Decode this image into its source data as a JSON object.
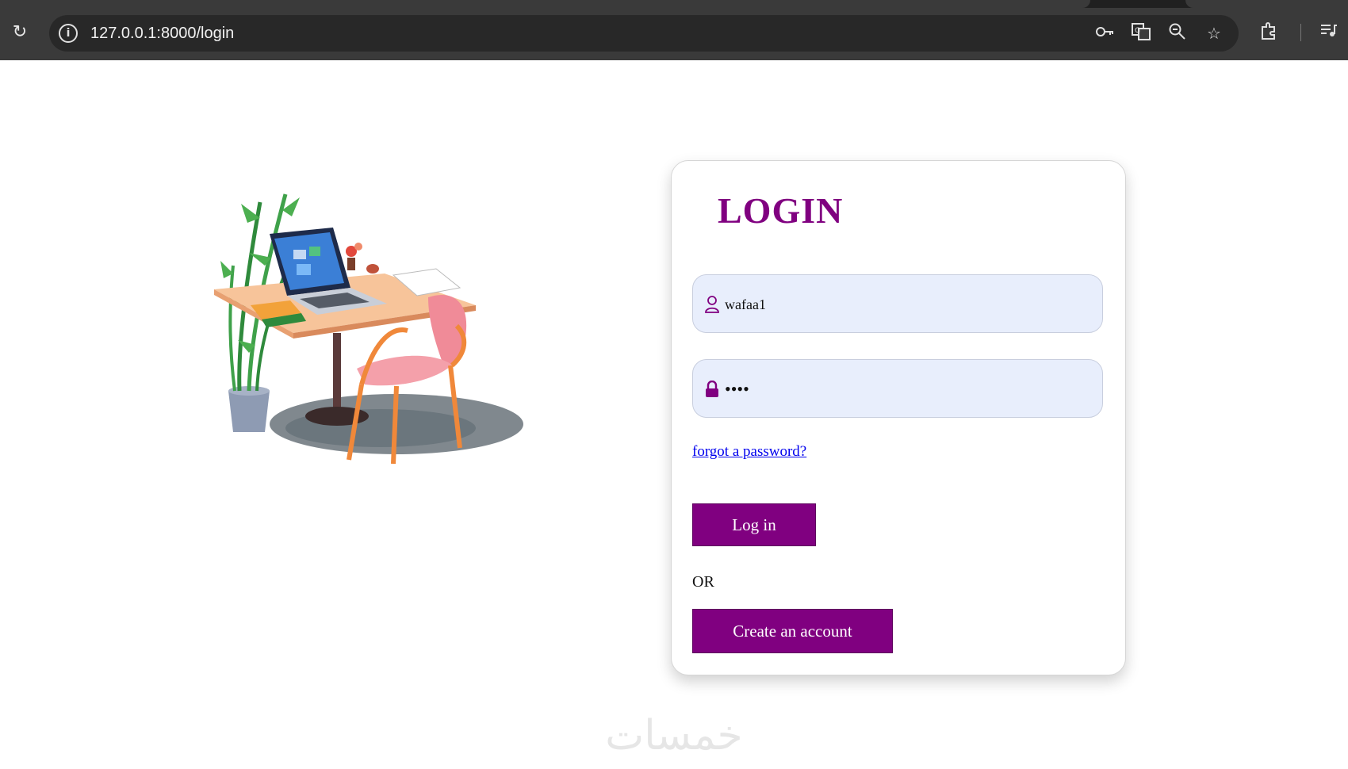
{
  "browser": {
    "url": "127.0.0.1:8000/login",
    "icons": [
      "reload-icon",
      "site-info-icon",
      "password-key-icon",
      "translate-icon",
      "zoom-icon",
      "bookmark-star-icon",
      "extensions-icon",
      "media-controls-icon"
    ]
  },
  "login": {
    "title": "LOGIN",
    "username_value": "wafaa1",
    "password_value": "••••",
    "forgot_link": "forgot a password?",
    "login_button": "Log in",
    "or_text": "OR",
    "create_button": "Create an account"
  },
  "colors": {
    "accent": "#800080",
    "input_bg": "#e8eefc",
    "link": "#0000ee"
  },
  "watermark": "خمسات"
}
